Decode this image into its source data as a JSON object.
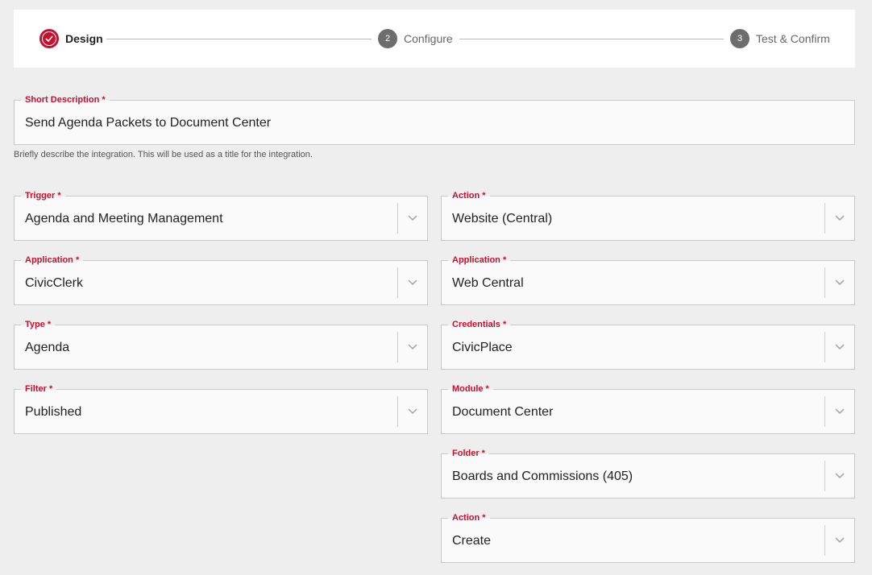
{
  "stepper": {
    "steps": [
      {
        "number": "",
        "label": "Design",
        "state": "done"
      },
      {
        "number": "2",
        "label": "Configure",
        "state": "pending"
      },
      {
        "number": "3",
        "label": "Test & Confirm",
        "state": "pending"
      }
    ]
  },
  "short_description": {
    "label": "Short Description *",
    "value": "Send Agenda Packets to Document Center",
    "helper": "Briefly describe the integration. This will be used as a title for the integration."
  },
  "left": {
    "trigger": {
      "label": "Trigger *",
      "value": "Agenda and Meeting Management"
    },
    "application": {
      "label": "Application *",
      "value": "CivicClerk"
    },
    "type": {
      "label": "Type *",
      "value": "Agenda"
    },
    "filter": {
      "label": "Filter *",
      "value": "Published"
    }
  },
  "right": {
    "action": {
      "label": "Action *",
      "value": "Website (Central)"
    },
    "application": {
      "label": "Application *",
      "value": "Web Central"
    },
    "credentials": {
      "label": "Credentials *",
      "value": "CivicPlace"
    },
    "module": {
      "label": "Module *",
      "value": "Document Center"
    },
    "folder": {
      "label": "Folder *",
      "value": "Boards and Commissions (405)"
    },
    "action2": {
      "label": "Action *",
      "value": "Create"
    }
  },
  "icons": {
    "step_done": "check-circle-icon",
    "dropdown": "chevron-down-icon"
  },
  "colors": {
    "accent": "#c8102e",
    "pending_step": "#6d6d6d",
    "background": "#eeeeee",
    "field_background": "#fafafa"
  }
}
